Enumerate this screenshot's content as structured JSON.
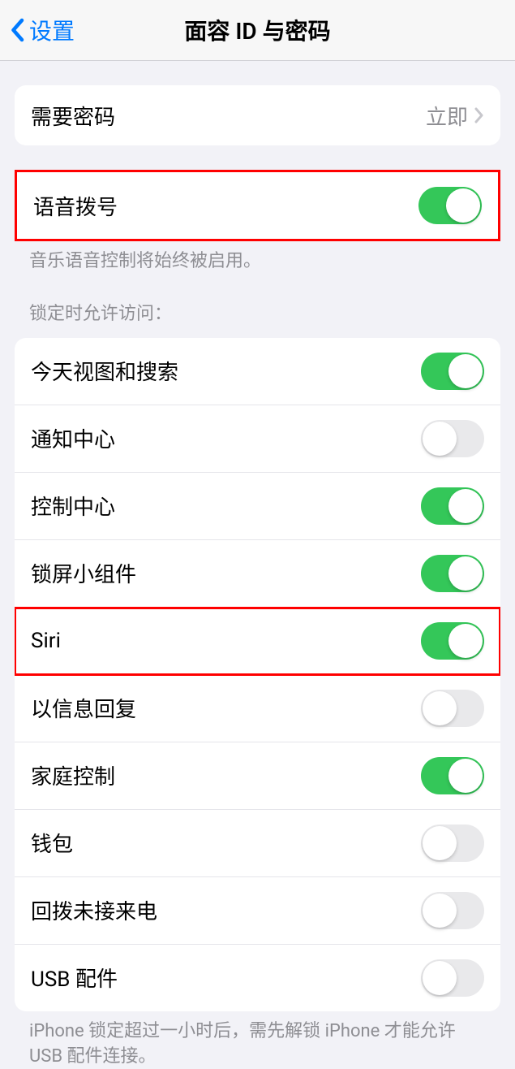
{
  "header": {
    "back_label": "设置",
    "title": "面容 ID 与密码"
  },
  "passcode_section": {
    "label": "需要密码",
    "value": "立即"
  },
  "voice_dial": {
    "label": "语音拨号",
    "enabled": true,
    "footer": "音乐语音控制将始终被启用。"
  },
  "locked_access": {
    "header": "锁定时允许访问：",
    "items": [
      {
        "label": "今天视图和搜索",
        "enabled": true
      },
      {
        "label": "通知中心",
        "enabled": false
      },
      {
        "label": "控制中心",
        "enabled": true
      },
      {
        "label": "锁屏小组件",
        "enabled": true
      },
      {
        "label": "Siri",
        "enabled": true
      },
      {
        "label": "以信息回复",
        "enabled": false
      },
      {
        "label": "家庭控制",
        "enabled": true
      },
      {
        "label": "钱包",
        "enabled": false
      },
      {
        "label": "回拨未接来电",
        "enabled": false
      },
      {
        "label": "USB 配件",
        "enabled": false
      }
    ],
    "footer": "iPhone 锁定超过一小时后，需先解锁 iPhone 才能允许USB 配件连接。"
  }
}
